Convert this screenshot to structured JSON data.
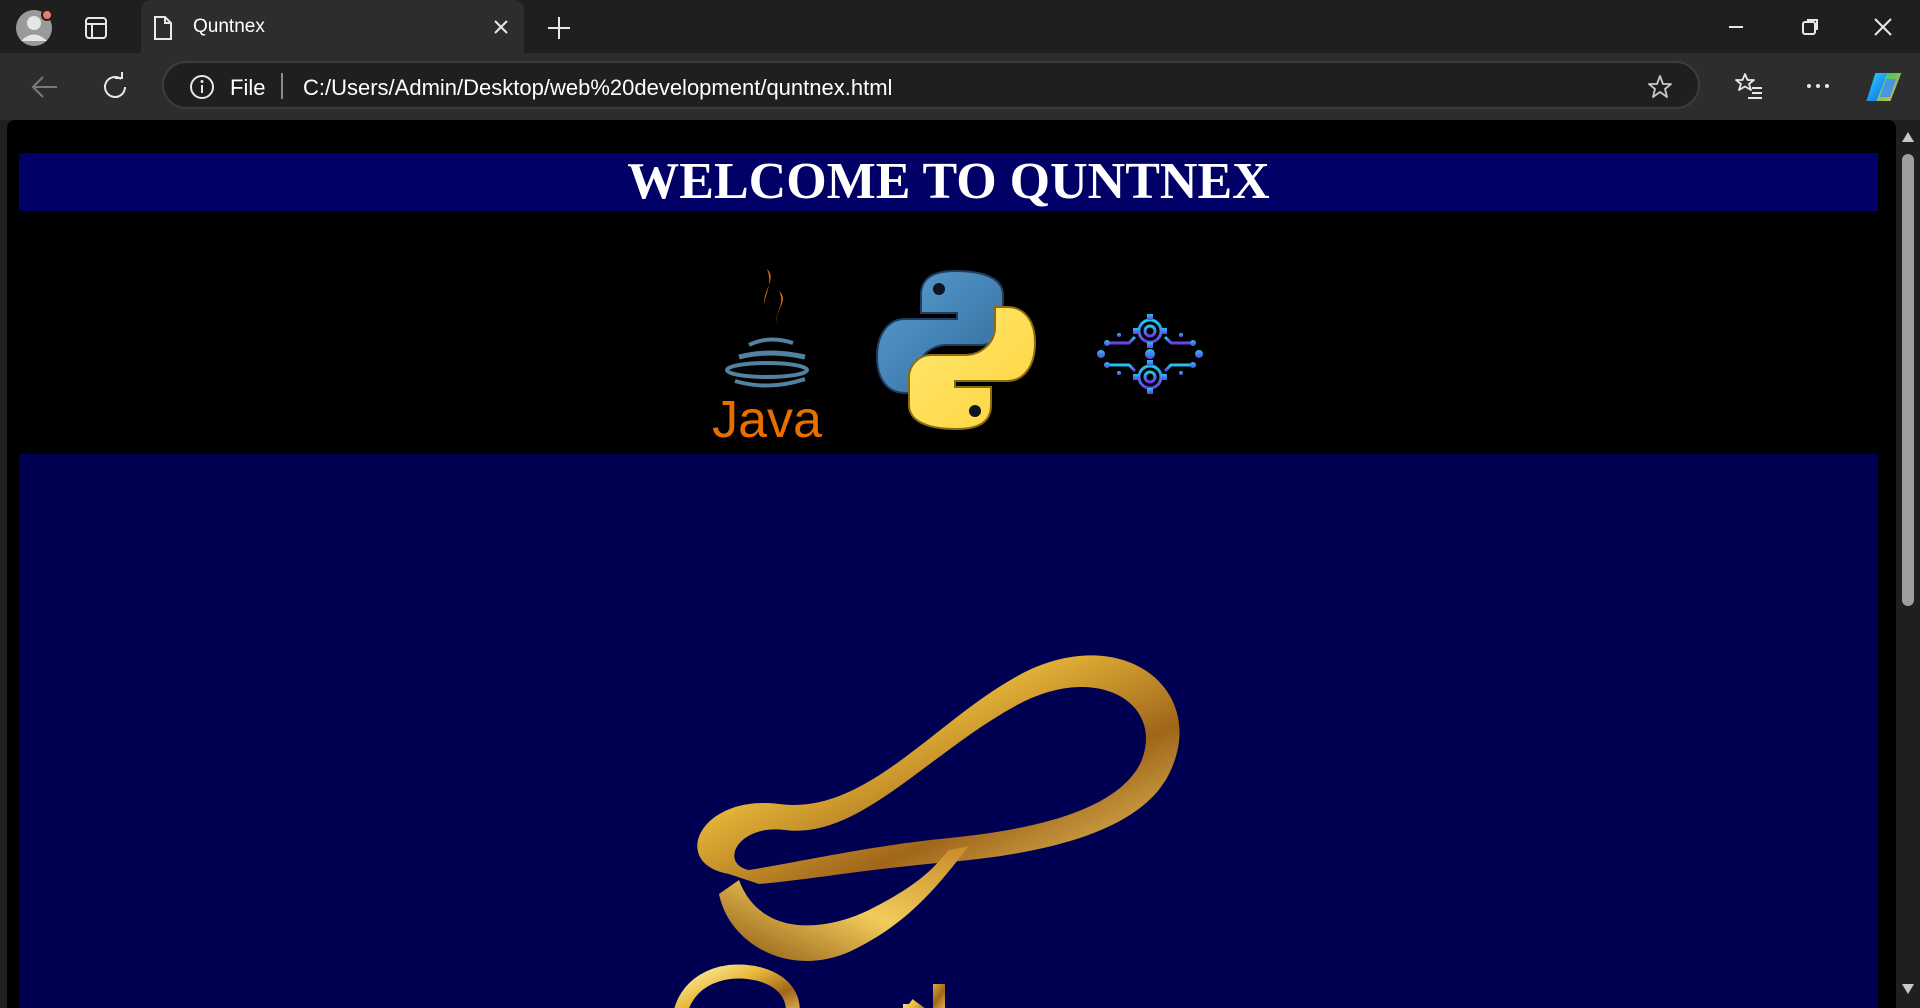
{
  "browser": {
    "tab": {
      "title": "Quntnex"
    },
    "address_bar": {
      "scheme_label": "File",
      "url": "C:/Users/Admin/Desktop/web%20development/quntnex.html"
    },
    "icons": {
      "profile": "profile-avatar-icon",
      "tab_actions": "tab-actions-icon",
      "close_tab": "close-icon",
      "new_tab": "plus-icon",
      "back": "back-arrow-icon",
      "reload": "reload-icon",
      "info": "info-icon",
      "favorite": "star-icon",
      "favorites": "favorites-list-icon",
      "more": "more-dots-icon",
      "copilot": "copilot-icon",
      "minimize": "minimize-icon",
      "restore": "restore-icon",
      "close_window": "close-icon"
    }
  },
  "page": {
    "heading": "WELCOME TO QUNTNEX",
    "logos": {
      "java_wordmark": "Java",
      "python": "python-logo",
      "ai": "ai-circuit-logo",
      "brand": "gold-infinity-logo"
    },
    "colors": {
      "banner": "#000066",
      "hero": "#000052",
      "logo_row": "#000000",
      "heading_text": "#ffffff"
    }
  }
}
